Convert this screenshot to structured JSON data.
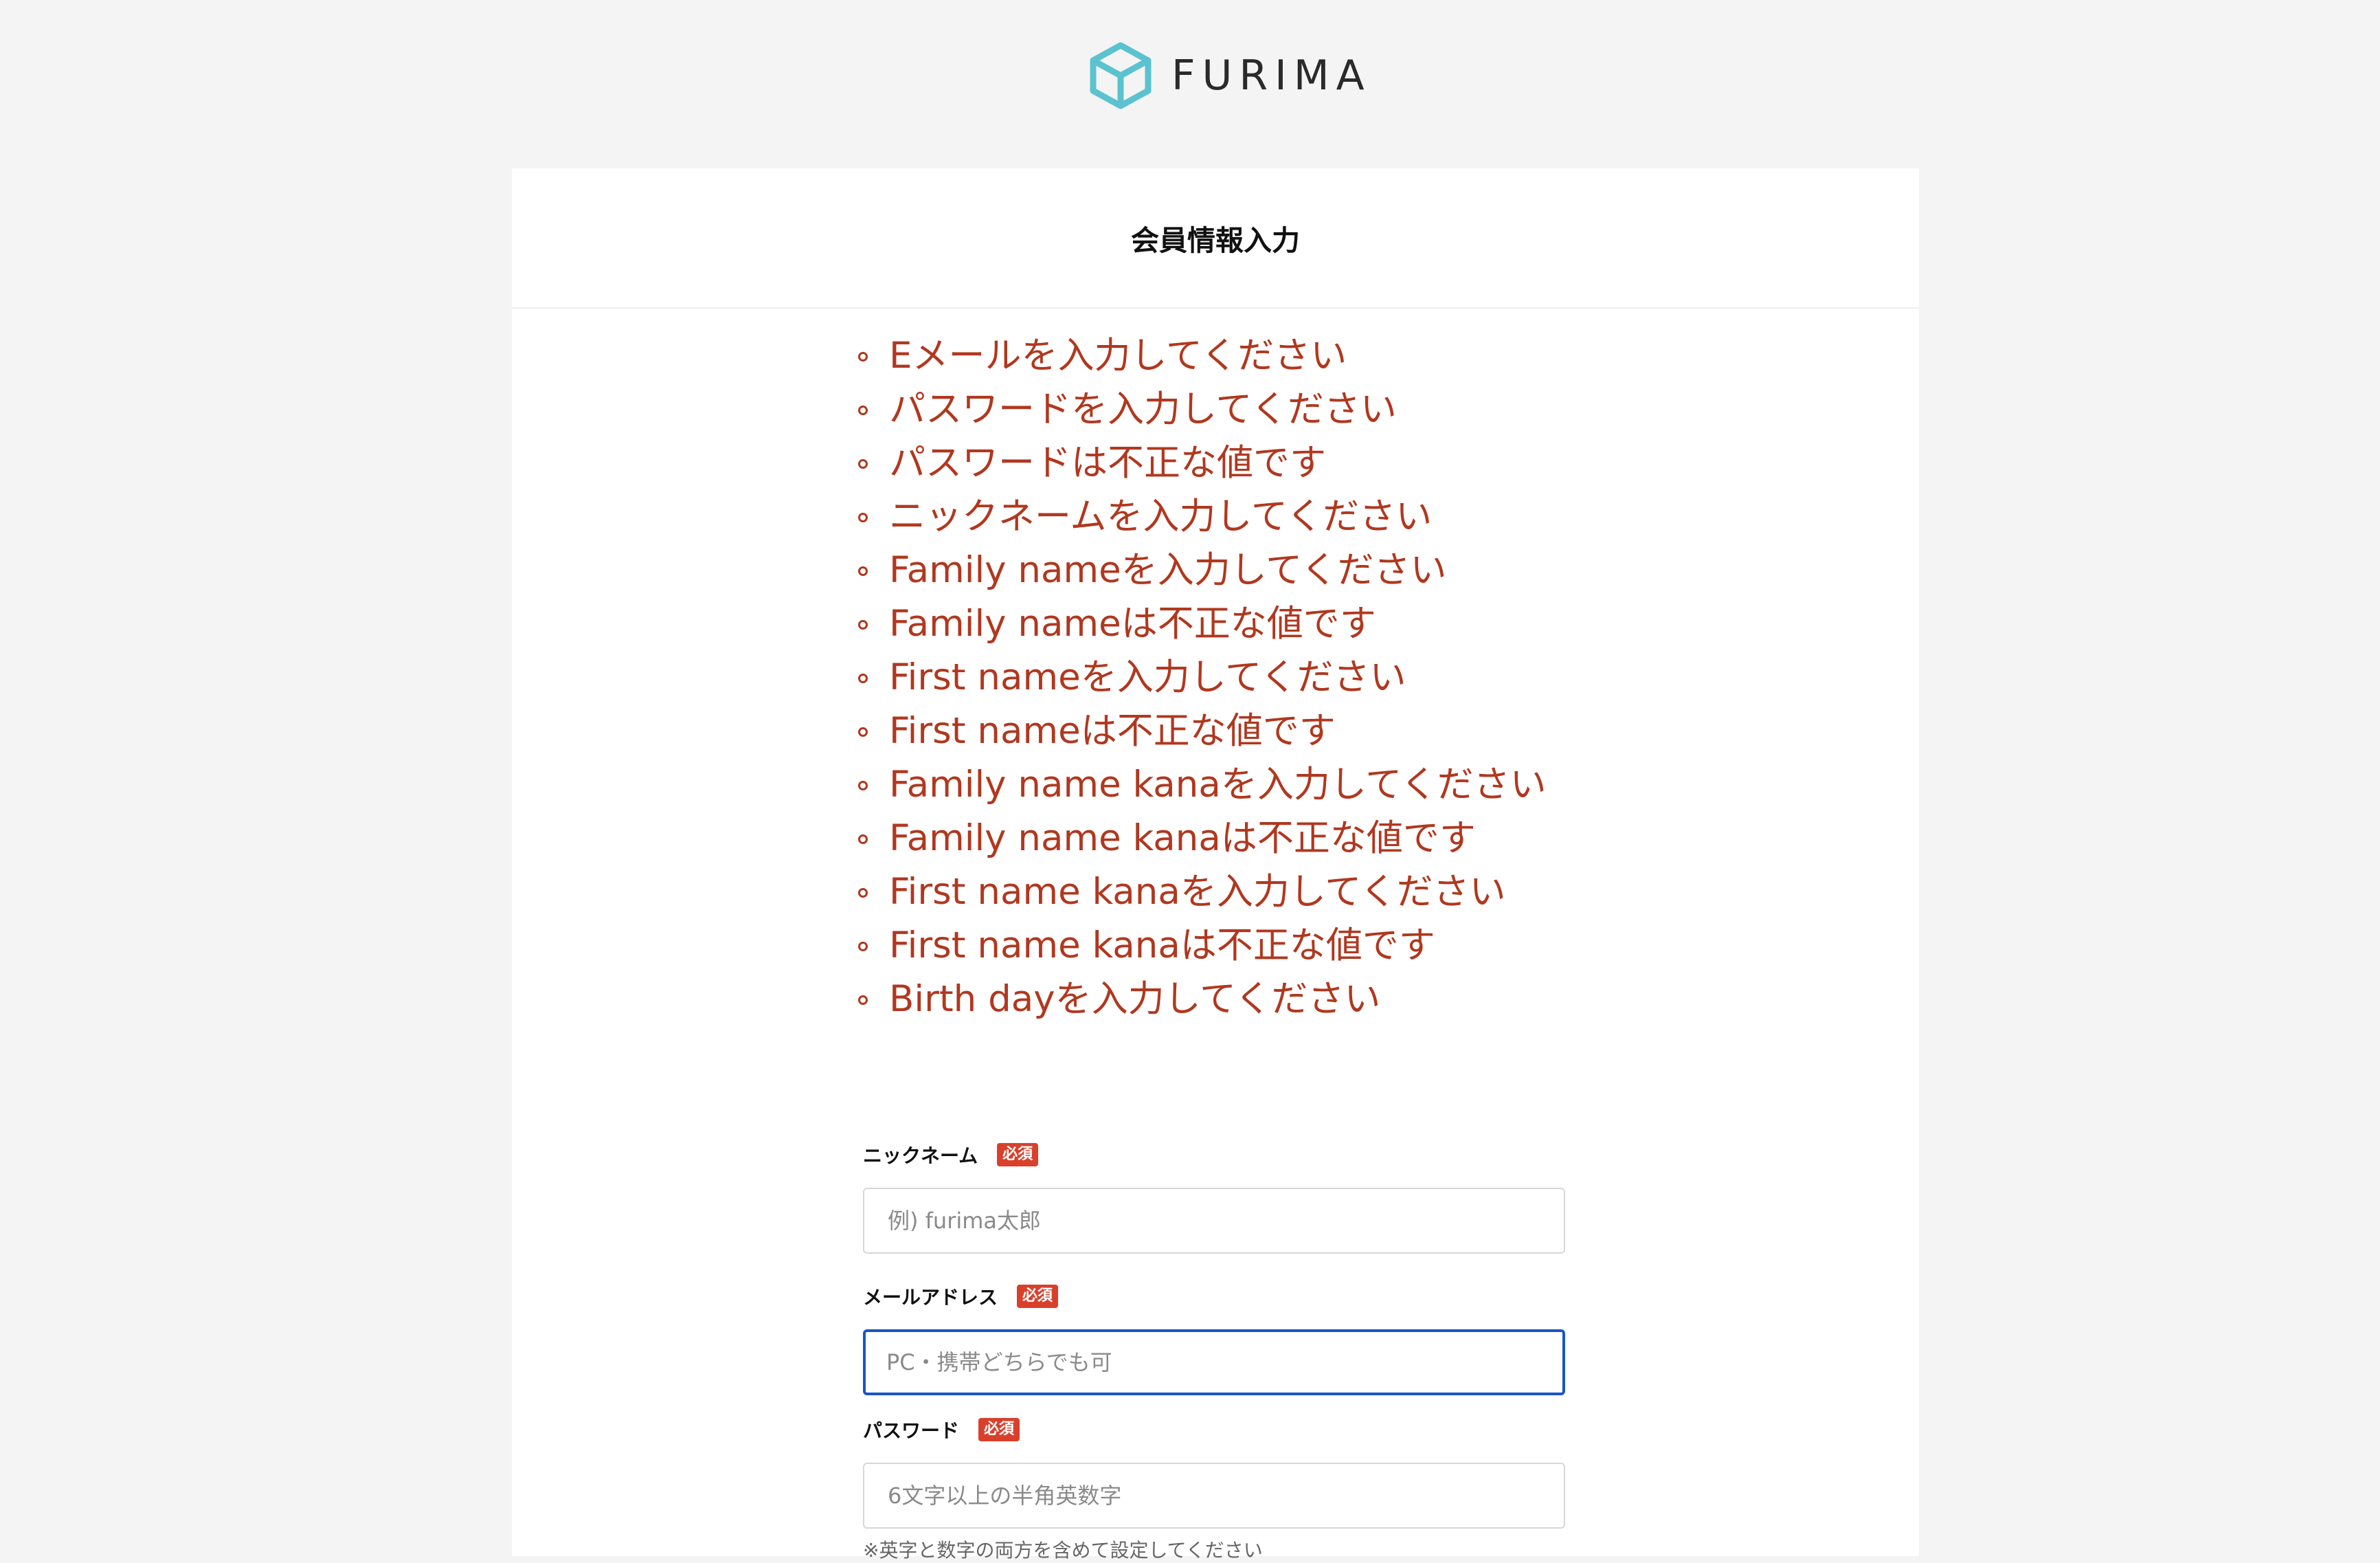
{
  "brand": {
    "name": "FURIMA",
    "color": "#5bc2cf"
  },
  "page": {
    "title": "会員情報入力"
  },
  "errors": [
    "Eメールを入力してください",
    "パスワードを入力してください",
    "パスワードは不正な値です",
    "ニックネームを入力してください",
    "Family nameを入力してください",
    "Family nameは不正な値です",
    "First nameを入力してください",
    "First nameは不正な値です",
    "Family name kanaを入力してください",
    "Family name kanaは不正な値です",
    "First name kanaを入力してください",
    "First name kanaは不正な値です",
    "Birth dayを入力してください"
  ],
  "error_color": "#b0381f",
  "form": {
    "required_badge": "必須",
    "nickname": {
      "label": "ニックネーム",
      "placeholder": "例) furima太郎",
      "value": ""
    },
    "email": {
      "label": "メールアドレス",
      "placeholder": "PC・携帯どちらでも可",
      "value": "",
      "focused": true
    },
    "password": {
      "label": "パスワード",
      "placeholder": "6文字以上の半角英数字",
      "value": "",
      "note": "※英字と数字の両方を含めて設定してください"
    }
  }
}
